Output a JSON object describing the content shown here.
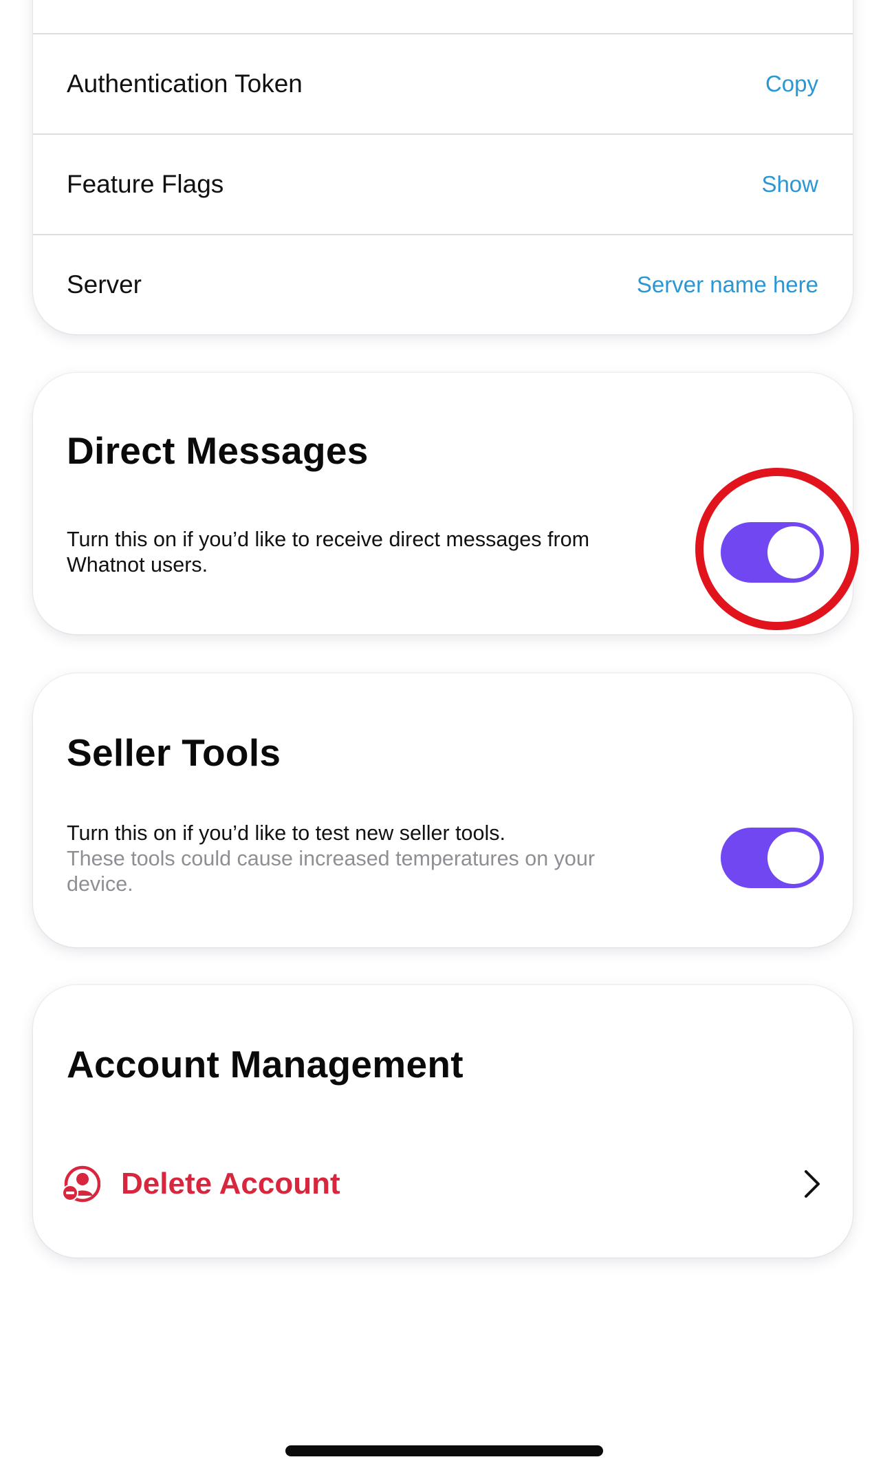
{
  "info_card": {
    "rows": [
      {
        "label": "Authentication Token",
        "action": "Copy"
      },
      {
        "label": "Feature Flags",
        "action": "Show"
      },
      {
        "label": "Server",
        "action": "Server name here"
      }
    ]
  },
  "direct_messages": {
    "title": "Direct Messages",
    "description": "Turn this on if you’d like to receive direct messages from Whatnot users.",
    "toggle_on": true
  },
  "seller_tools": {
    "title": "Seller Tools",
    "description": "Turn this on if you’d like to test new seller tools.",
    "warning": "These tools could cause increased temperatures on your device.",
    "toggle_on": true
  },
  "account_management": {
    "title": "Account Management",
    "delete_label": "Delete Account",
    "delete_icon": "user-remove-icon",
    "chevron_icon": "chevron-right-icon"
  },
  "colors": {
    "accent_purple": "#7047f0",
    "link_blue": "#2a97d4",
    "danger_red": "#d7263d",
    "highlight_red": "#e1141e",
    "muted_gray": "#8e8f94"
  }
}
